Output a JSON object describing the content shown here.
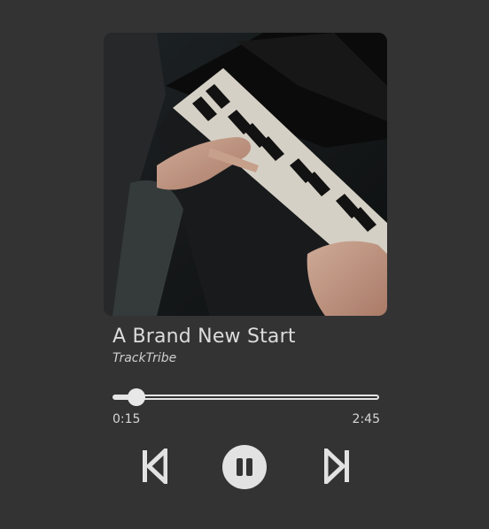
{
  "track": {
    "title": "A Brand New Start",
    "artist": "TrackTribe"
  },
  "progress": {
    "current": "0:15",
    "duration": "2:45",
    "fraction": 0.09
  },
  "controls": {
    "prev_icon": "skip-previous-icon",
    "play_pause_icon": "pause-icon",
    "next_icon": "skip-next-icon"
  },
  "colors": {
    "background": "#333333",
    "accent": "#e6e6e6"
  }
}
